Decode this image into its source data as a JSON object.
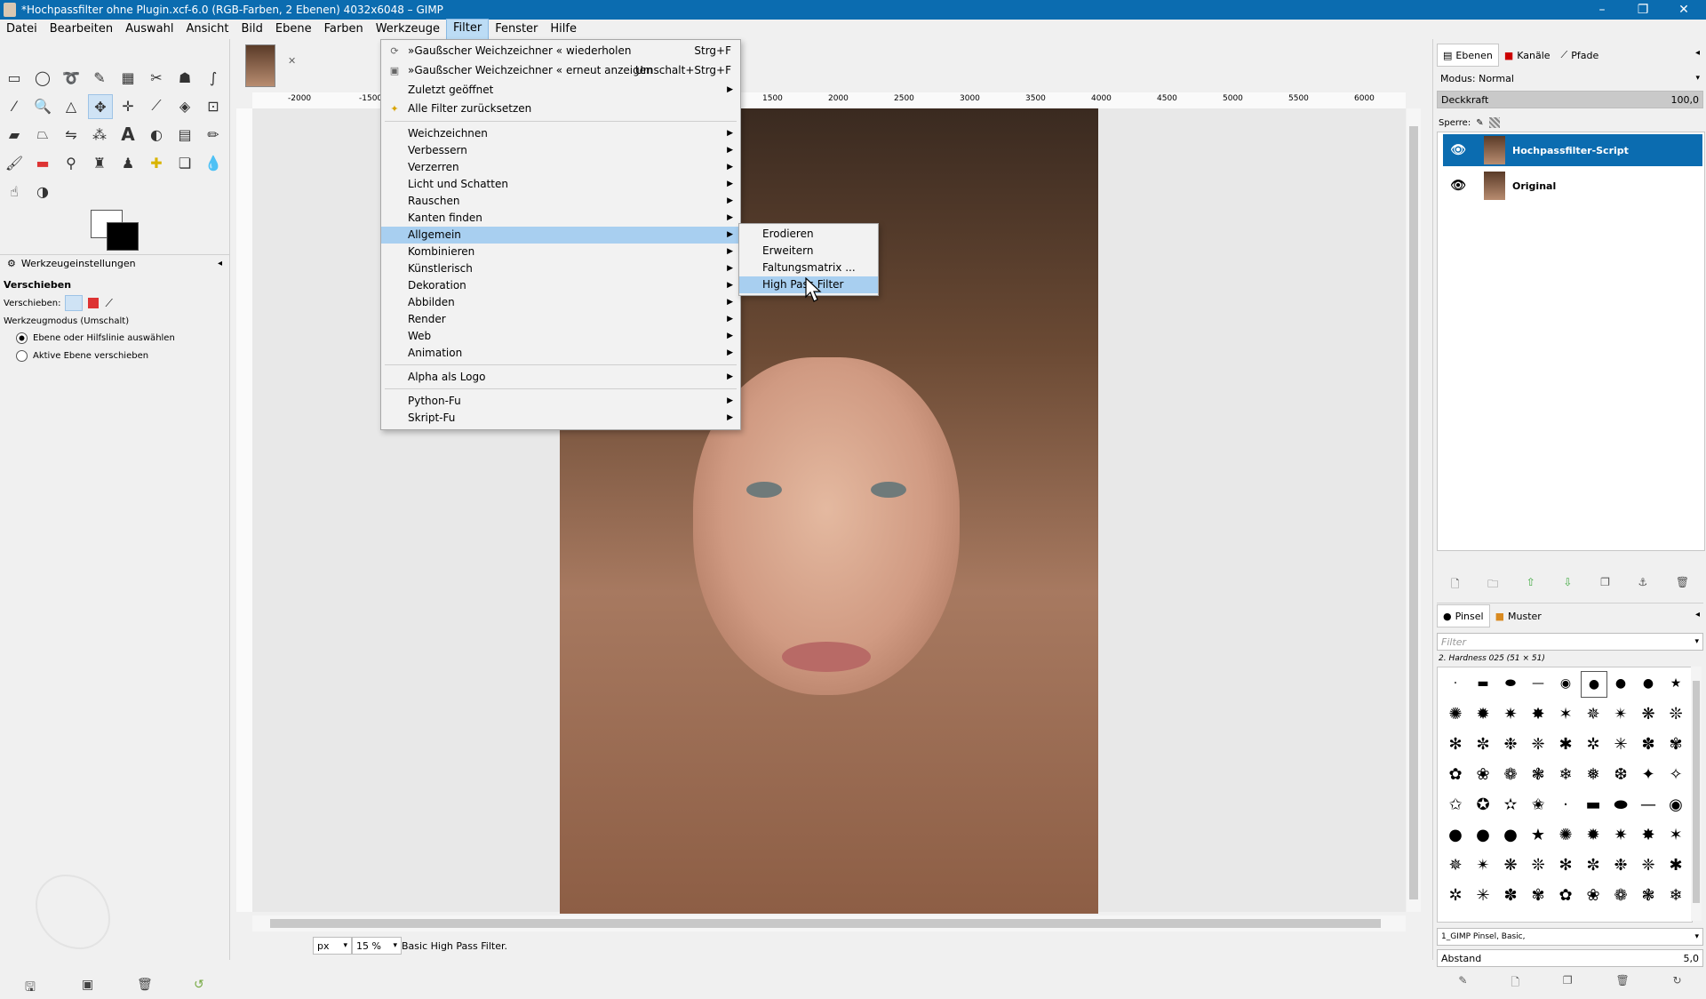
{
  "window": {
    "title": "*Hochpassfilter ohne Plugin.xcf-6.0 (RGB-Farben, 2 Ebenen) 4032x6048 – GIMP",
    "controls": [
      "–",
      "❐",
      "✕"
    ]
  },
  "menubar": {
    "items": [
      "Datei",
      "Bearbeiten",
      "Auswahl",
      "Ansicht",
      "Bild",
      "Ebene",
      "Farben",
      "Werkzeuge",
      "Filter",
      "Fenster",
      "Hilfe"
    ],
    "active": "Filter"
  },
  "filter_menu": {
    "top_items": [
      {
        "label": "»Gaußscher Weichzeichner « wiederholen",
        "shortcut": "Strg+F",
        "icon": "repeat-icon"
      },
      {
        "label": "»Gaußscher Weichzeichner « erneut anzeigen",
        "shortcut": "Umschalt+Strg+F",
        "icon": "reshow-icon"
      },
      {
        "label": "Zuletzt geöffnet",
        "shortcut": "",
        "icon": ""
      },
      {
        "label": "Alle Filter zurücksetzen",
        "shortcut": "",
        "icon": "reset-icon"
      }
    ],
    "groups": [
      "Weichzeichnen",
      "Verbessern",
      "Verzerren",
      "Licht und Schatten",
      "Rauschen",
      "Kanten finden",
      "Allgemein",
      "Kombinieren",
      "Künstlerisch",
      "Dekoration",
      "Abbilden",
      "Render",
      "Web",
      "Animation"
    ],
    "highlighted": "Allgemein",
    "logo": "Alpha als Logo",
    "scripts": [
      "Python-Fu",
      "Skript-Fu"
    ]
  },
  "submenu_allgemein": {
    "items": [
      "Erodieren",
      "Erweitern",
      "Faltungsmatrix ...",
      "High Pass Filter"
    ],
    "highlighted": "High Pass Filter"
  },
  "tool_options": {
    "tab_label": "Werkzeugeinstellungen",
    "tool_name": "Verschieben",
    "move_label": "Verschieben:",
    "mode_label": "Werkzeugmodus (Umschalt)",
    "options": [
      "Ebene oder Hilfslinie auswählen",
      "Aktive Ebene verschieben"
    ],
    "selected_option": 0
  },
  "ruler": {
    "labels": [
      "-2000",
      "-1500",
      "1500",
      "2000",
      "2500",
      "3000",
      "3500",
      "4000",
      "4500",
      "5000",
      "5500",
      "6000"
    ]
  },
  "status": {
    "unit": "px",
    "zoom": "15 %",
    "message": "Basic High Pass Filter."
  },
  "layers_dock": {
    "tabs": [
      "Ebenen",
      "Kanäle",
      "Pfade"
    ],
    "mode_label": "Modus: Normal",
    "opacity_label": "Deckkraft",
    "opacity_value": "100,0",
    "lock_label": "Sperre:",
    "layers": [
      {
        "name": "Hochpassfilter-Script",
        "selected": true
      },
      {
        "name": "Original",
        "selected": false
      }
    ]
  },
  "brushes_dock": {
    "tabs": [
      "Pinsel",
      "Muster"
    ],
    "filter_placeholder": "Filter",
    "current_brush": "2. Hardness 025 (51 × 51)",
    "brush_set": "1_GIMP Pinsel, Basic,",
    "spacing_label": "Abstand",
    "spacing_value": "5,0"
  },
  "colors": {
    "accent": "#0b6cb0",
    "menu_highlight": "#a8cff0"
  }
}
